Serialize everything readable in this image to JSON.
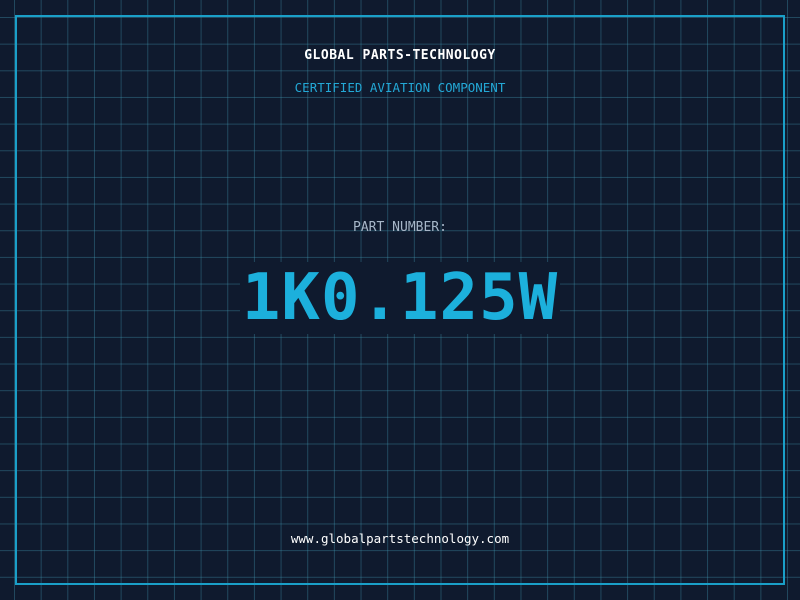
{
  "company_name": "GLOBAL PARTS-TECHNOLOGY",
  "subtitle": "CERTIFIED AVIATION COMPONENT",
  "part_number_label": "PART NUMBER:",
  "part_number": "1K0.125W",
  "website": "www.globalpartstechnology.com",
  "colors": {
    "background": "#0f1a2e",
    "accent": "#1cb0dc",
    "grid": "#2f7f9a",
    "frame": "#1a9fc8"
  }
}
